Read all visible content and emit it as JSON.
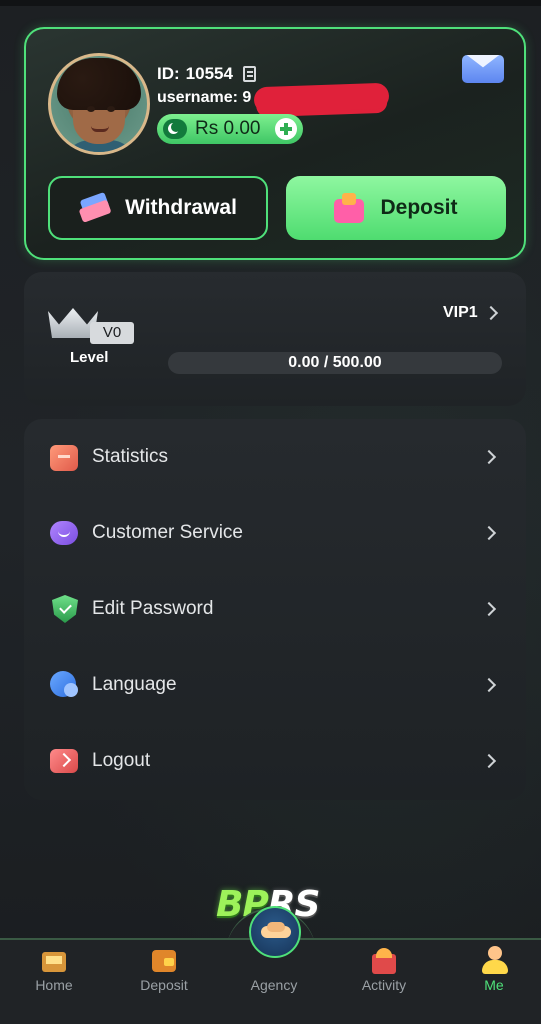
{
  "profile": {
    "id_label": "ID:",
    "id_value": "10554",
    "username_label": "username:",
    "username_value": "9",
    "balance": "Rs 0.00",
    "withdraw_label": "Withdrawal",
    "deposit_label": "Deposit"
  },
  "vip": {
    "badge": "V0",
    "level_label": "Level",
    "next_level": "VIP1",
    "progress_text": "0.00 / 500.00",
    "progress_fraction": 0.0
  },
  "menu": {
    "items": [
      {
        "label": "Statistics",
        "icon": "statistics-icon"
      },
      {
        "label": "Customer Service",
        "icon": "customer-service-icon"
      },
      {
        "label": "Edit Password",
        "icon": "shield-icon"
      },
      {
        "label": "Language",
        "icon": "globe-icon"
      },
      {
        "label": "Logout",
        "icon": "logout-icon"
      }
    ]
  },
  "logo": {
    "part1": "BP",
    "part2": "RS"
  },
  "nav": {
    "items": [
      {
        "label": "Home",
        "icon": "home-icon",
        "active": false
      },
      {
        "label": "Deposit",
        "icon": "wallet-icon",
        "active": false
      },
      {
        "label": "Agency",
        "icon": "handshake-icon",
        "active": false
      },
      {
        "label": "Activity",
        "icon": "gift-icon",
        "active": false
      },
      {
        "label": "Me",
        "icon": "user-icon",
        "active": true
      }
    ]
  },
  "colors": {
    "accent": "#4fe07a",
    "background": "#1c1f22",
    "redaction": "#e0213a"
  }
}
